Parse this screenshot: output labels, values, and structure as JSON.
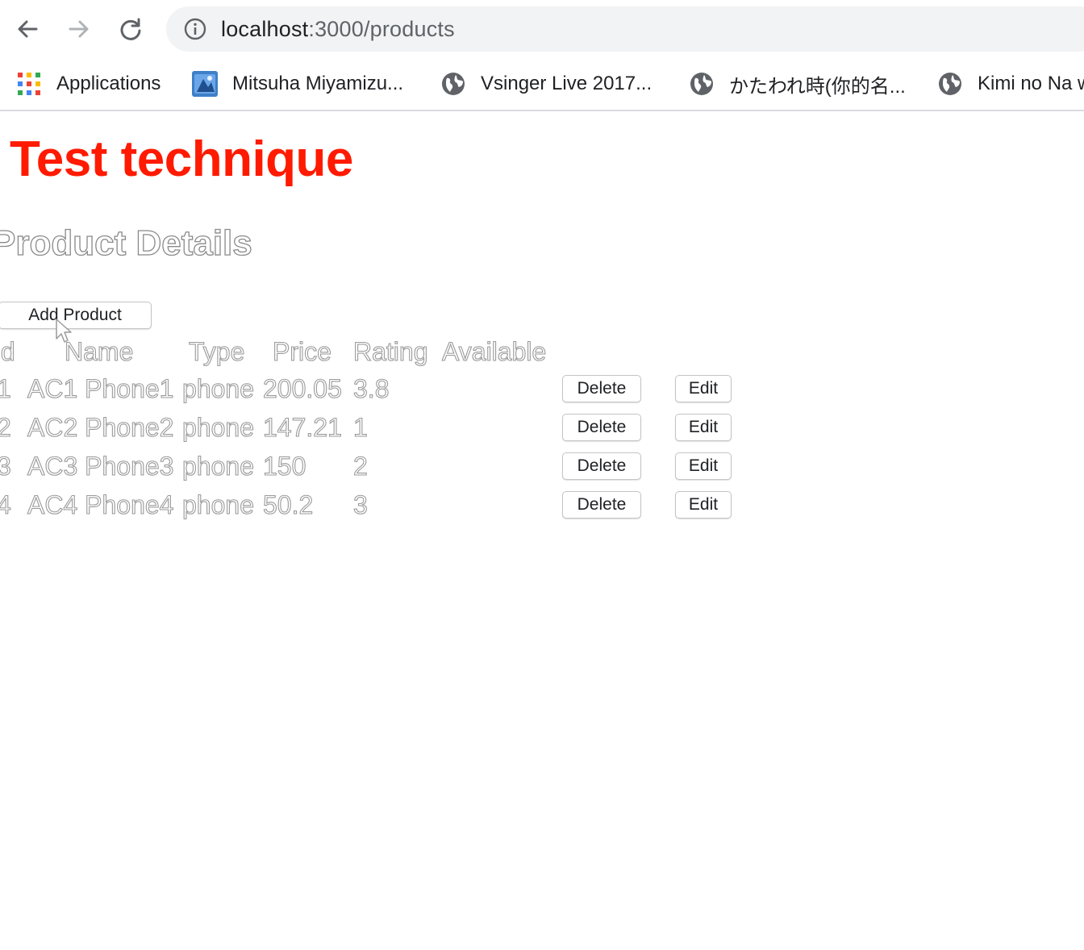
{
  "browser": {
    "url_host": "localhost",
    "url_path": ":3000/products",
    "icons": {
      "back": "arrow-left-icon",
      "forward": "arrow-right-icon",
      "reload": "reload-icon",
      "site_info": "info-icon"
    },
    "bookmarks": [
      {
        "label": "Applications",
        "icon": "apps-grid-icon"
      },
      {
        "label": "Mitsuha Miyamizu...",
        "icon": "image-thumbnail-icon"
      },
      {
        "label": "Vsinger Live 2017...",
        "icon": "globe-icon"
      },
      {
        "label": "かたわれ時(你的名...",
        "icon": "globe-icon"
      },
      {
        "label": "Kimi no Na w",
        "icon": "globe-icon"
      }
    ]
  },
  "page": {
    "title": "Test technique",
    "title_color": "#ff1a00",
    "section_title": "Product Details",
    "add_button": "Add Product",
    "table": {
      "headers": [
        "Id",
        "Name",
        "Type",
        "Price",
        "Rating",
        "Available"
      ],
      "rows": [
        {
          "id": "1",
          "name": "AC1 Phone1",
          "type": "phone",
          "price": "200.05",
          "rating": "3.8",
          "available": "",
          "delete": "Delete",
          "edit": "Edit"
        },
        {
          "id": "2",
          "name": "AC2 Phone2",
          "type": "phone",
          "price": "147.21",
          "rating": "1",
          "available": "",
          "delete": "Delete",
          "edit": "Edit"
        },
        {
          "id": "3",
          "name": "AC3 Phone3",
          "type": "phone",
          "price": "150",
          "rating": "2",
          "available": "",
          "delete": "Delete",
          "edit": "Edit"
        },
        {
          "id": "4",
          "name": "AC4 Phone4",
          "type": "phone",
          "price": "50.2",
          "rating": "3",
          "available": "",
          "delete": "Delete",
          "edit": "Edit"
        }
      ]
    }
  }
}
